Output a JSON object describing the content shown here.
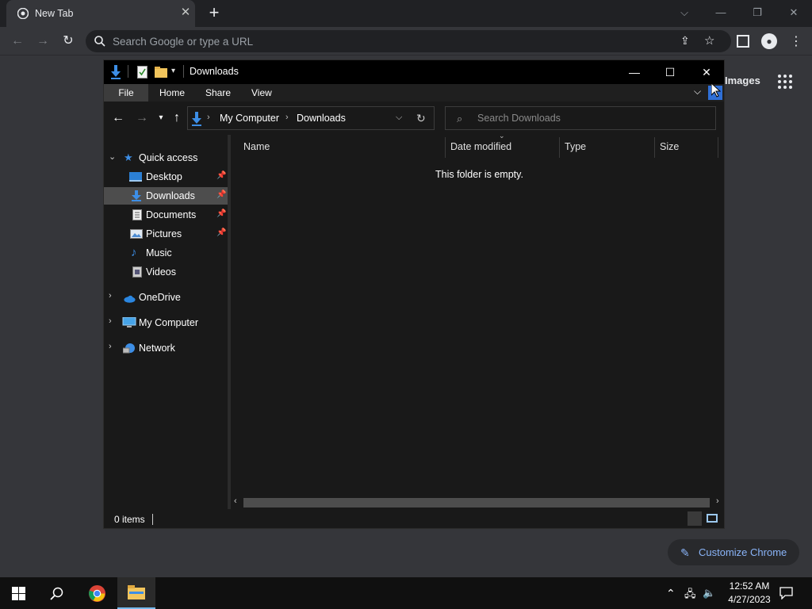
{
  "chrome": {
    "tab_title": "New Tab",
    "omnibox_placeholder": "Search Google or type a URL",
    "images_link": "Images",
    "customize_label": "Customize Chrome"
  },
  "explorer": {
    "title": "Downloads",
    "ribbon": {
      "file": "File",
      "home": "Home",
      "share": "Share",
      "view": "View"
    },
    "breadcrumb": [
      "My Computer",
      "Downloads"
    ],
    "search_placeholder": "Search Downloads",
    "nav": {
      "quick_access": "Quick access",
      "desktop": "Desktop",
      "downloads": "Downloads",
      "documents": "Documents",
      "pictures": "Pictures",
      "music": "Music",
      "videos": "Videos",
      "onedrive": "OneDrive",
      "my_computer": "My Computer",
      "network": "Network"
    },
    "columns": {
      "name": "Name",
      "date_modified": "Date modified",
      "type": "Type",
      "size": "Size"
    },
    "empty_message": "This folder is empty.",
    "status": "0 items"
  },
  "taskbar": {
    "time": "12:52 AM",
    "date": "4/27/2023"
  },
  "colors": {
    "accent": "#0078d7",
    "chrome_link": "#8ab4f8",
    "selection": "#4d4d4d"
  }
}
